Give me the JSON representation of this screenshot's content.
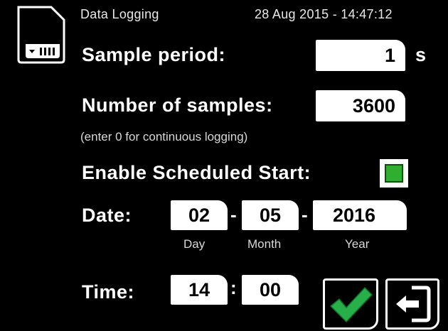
{
  "header": {
    "title": "Data Logging",
    "datetime": "28 Aug 2015 - 14:47:12"
  },
  "sample_period": {
    "label": "Sample period:",
    "value": "1",
    "unit": "s"
  },
  "num_samples": {
    "label": "Number of samples:",
    "value": "3600",
    "hint": "(enter 0 for continuous logging)"
  },
  "scheduled_start": {
    "label": "Enable Scheduled Start:",
    "checked": true
  },
  "date": {
    "label": "Date:",
    "day": "02",
    "month": "05",
    "year": "2016",
    "separator": "-",
    "day_caption": "Day",
    "month_caption": "Month",
    "year_caption": "Year"
  },
  "time": {
    "label": "Time:",
    "hour": "14",
    "minute": "00",
    "separator": ":"
  },
  "icons": {
    "sd_card": "sd-card-icon",
    "confirm": "checkmark-icon",
    "exit": "exit-icon"
  },
  "colors": {
    "background": "#000000",
    "field": "#ffffff",
    "checkbox": "#2fae2f",
    "checkmark": "#27b04a"
  }
}
